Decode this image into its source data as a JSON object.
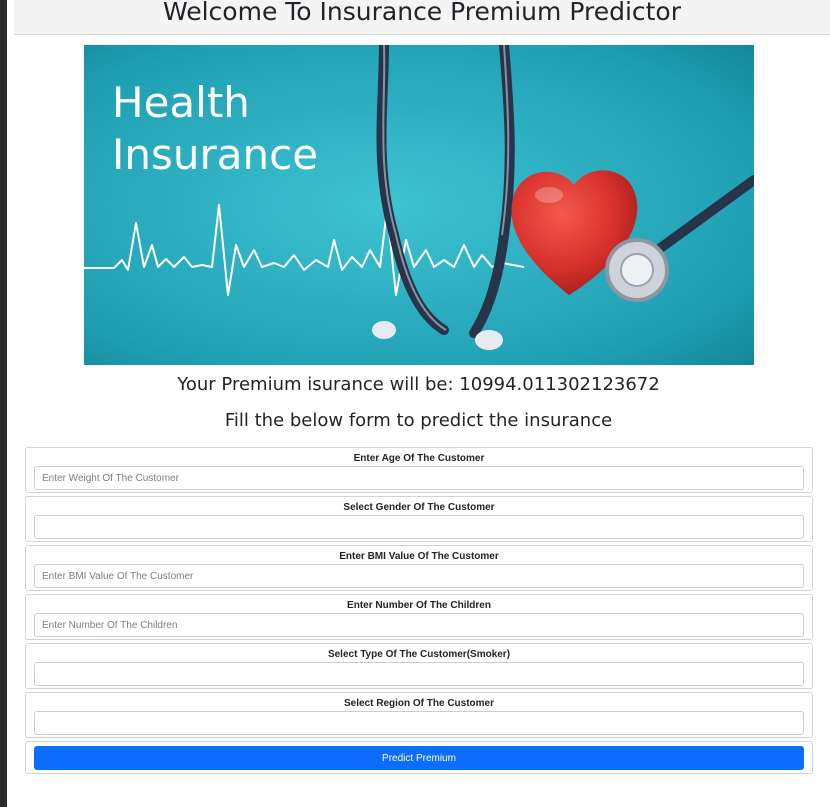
{
  "header": {
    "title": "Welcome To Insurance Premium Predictor"
  },
  "banner": {
    "line1": "Health",
    "line2": "Insurance"
  },
  "result": {
    "text": "Your Premium isurance will be: 10994.011302123672"
  },
  "subtitle": "Fill the below form to predict the insurance",
  "form": {
    "age": {
      "label": "Enter Age Of The Customer",
      "placeholder": "Enter Weight Of The Customer"
    },
    "gender": {
      "label": "Select Gender Of The Customer"
    },
    "bmi": {
      "label": "Enter BMI Value Of The Customer",
      "placeholder": "Enter BMI Value Of The Customer"
    },
    "children": {
      "label": "Enter Number Of The Children",
      "placeholder": "Enter Number Of The Children"
    },
    "smoker": {
      "label": "Select Type Of The Customer(Smoker)"
    },
    "region": {
      "label": "Select Region Of The Customer"
    },
    "submit_label": "Predict Premium"
  },
  "colors": {
    "primary": "#0d6efd",
    "banner_bg": "#22a6b8",
    "heart": "#d8312c"
  }
}
